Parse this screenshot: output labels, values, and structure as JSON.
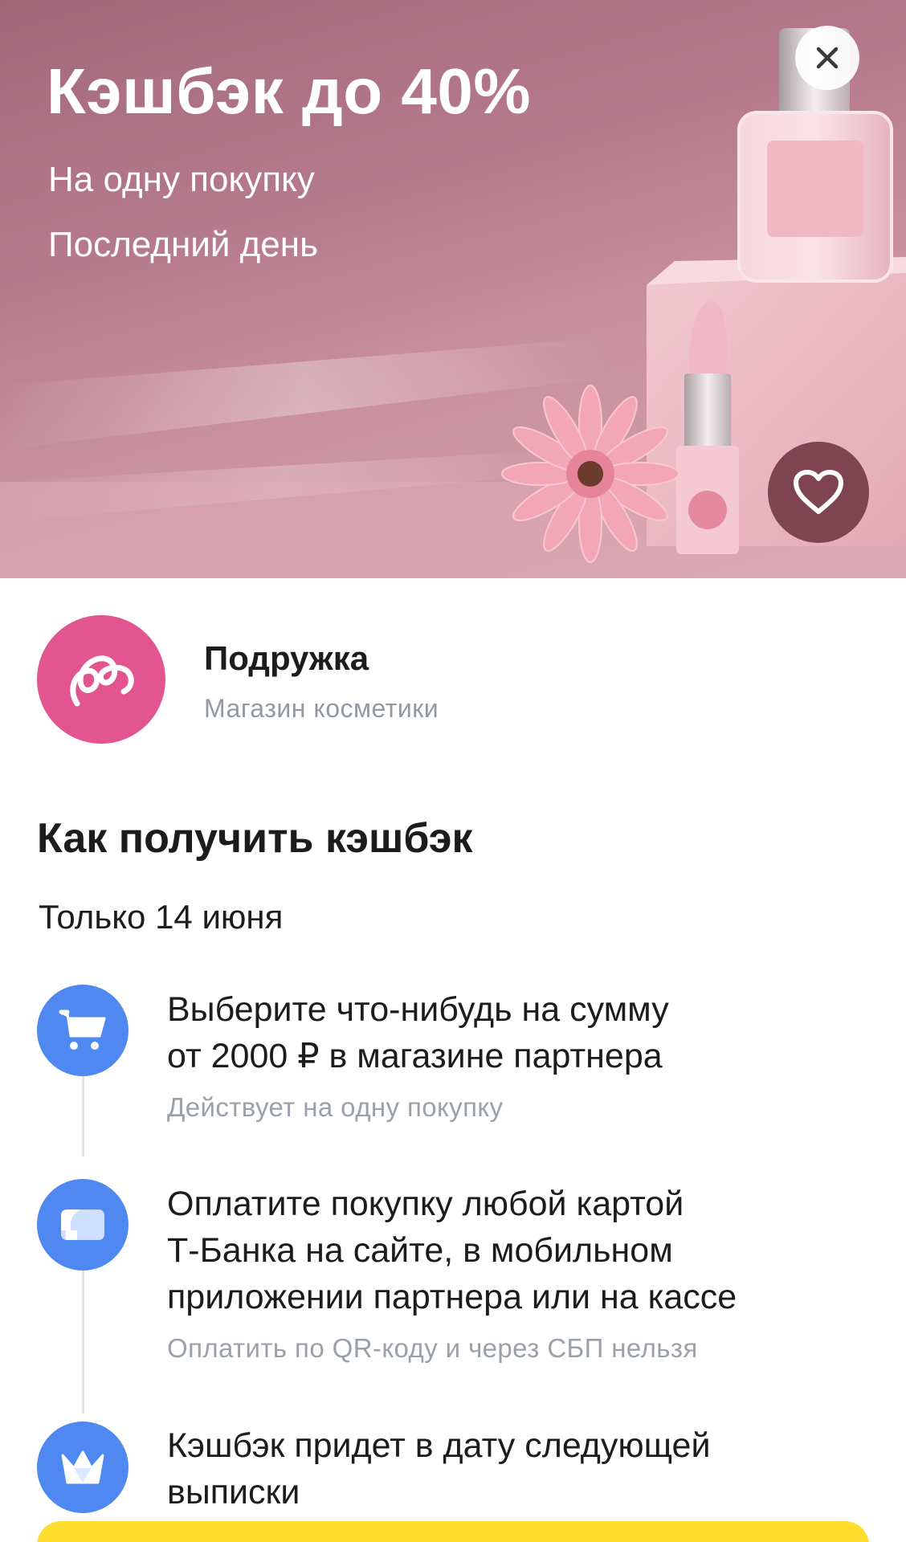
{
  "hero": {
    "title": "Кэшбэк до 40%",
    "subtitle_1": "На одну покупку",
    "subtitle_2": "Последний день",
    "close_icon": "close-icon",
    "favorite_icon": "heart-icon"
  },
  "partner": {
    "name": "Подружка",
    "category": "Магазин косметики",
    "logo_color": "#e2558e"
  },
  "how_to": {
    "title": "Как получить кэшбэк",
    "date": "Только 14 июня",
    "steps": [
      {
        "icon": "cart-icon",
        "line_1": "Выберите что-нибудь на сумму",
        "line_2": "от 2000 ₽ в магазине партнера",
        "note": "Действует на одну покупку"
      },
      {
        "icon": "card-icon",
        "line_1": "Оплатите покупку любой картой",
        "line_2": "Т-Банка на сайте, в мобильном",
        "line_3": "приложении партнера или на кассе",
        "note": "Оплатить по QR-коду и через СБП нельзя"
      },
      {
        "icon": "crown-icon",
        "line_1": "Кэшбэк придет в дату следующей",
        "line_2": "выписки"
      }
    ]
  },
  "colors": {
    "accent_blue": "#4e88f0",
    "brand_yellow": "#ffdd2d",
    "hero_pink": "#b57a8c"
  }
}
